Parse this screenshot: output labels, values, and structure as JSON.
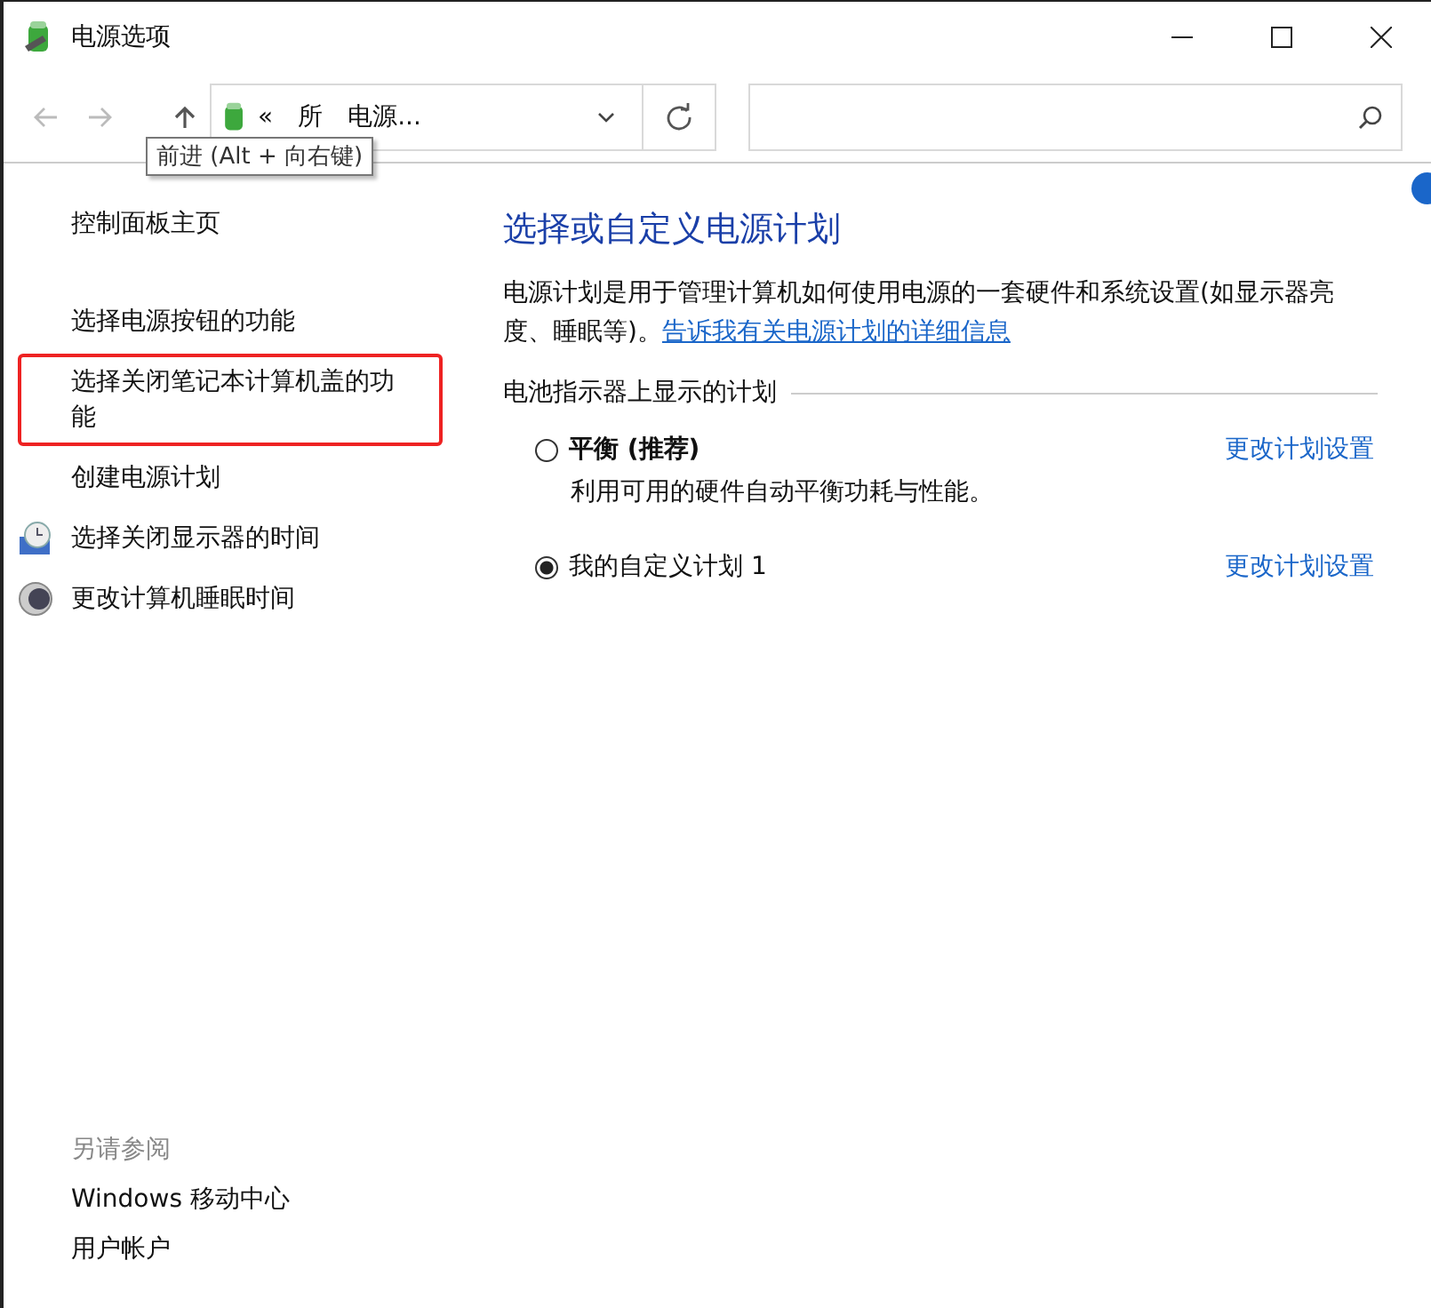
{
  "window": {
    "title": "电源选项"
  },
  "address_bar": {
    "segments": [
      "«",
      "所",
      "电源..."
    ],
    "tooltip": "前进 (Alt + 向右键)"
  },
  "sidebar": {
    "items": [
      {
        "label": "控制面板主页",
        "kind": "home",
        "highlighted": false
      },
      {
        "label": "选择电源按钮的功能",
        "kind": "link",
        "highlighted": false
      },
      {
        "label": "选择关闭笔记本计算机盖的功能",
        "kind": "link",
        "highlighted": true
      },
      {
        "label": "创建电源计划",
        "kind": "link",
        "highlighted": false
      },
      {
        "label": "选择关闭显示器的时间",
        "kind": "clock",
        "highlighted": false
      },
      {
        "label": "更改计算机睡眠时间",
        "kind": "moon",
        "highlighted": false
      }
    ],
    "see_also": {
      "heading": "另请参阅",
      "items": [
        "Windows 移动中心",
        "用户帐户"
      ]
    }
  },
  "content": {
    "title": "选择或自定义电源计划",
    "description": "电源计划是用于管理计算机如何使用电源的一套硬件和系统设置(如显示器亮度、睡眠等)。",
    "link": "告诉我有关电源计划的详细信息",
    "group": "电池指示器上显示的计划",
    "plans": [
      {
        "name": "平衡 (推荐)",
        "bold": true,
        "description": "利用可用的硬件自动平衡功耗与性能。",
        "selected": false,
        "action": "更改计划设置"
      },
      {
        "name": "我的自定义计划 1",
        "bold": false,
        "selected": true,
        "action": "更改计划设置"
      }
    ]
  }
}
